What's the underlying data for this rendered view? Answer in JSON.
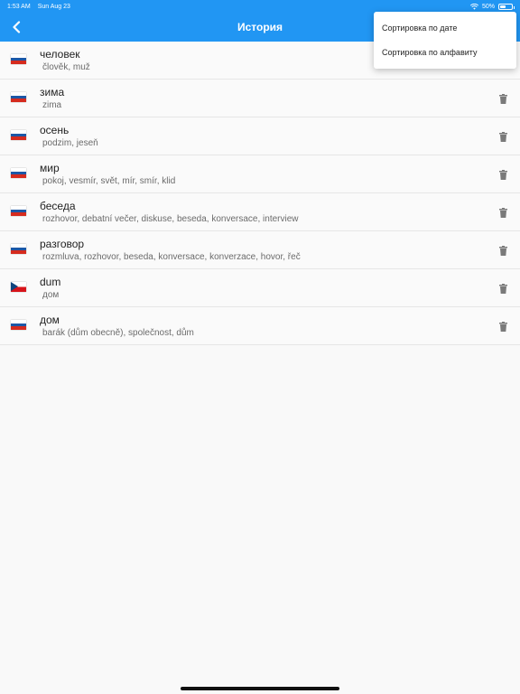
{
  "status": {
    "time": "1:53 AM",
    "date": "Sun Aug 23",
    "battery": "50%",
    "battery_level": 0.5
  },
  "header": {
    "title": "История"
  },
  "menu": {
    "items": [
      "Сортировка по дате",
      "Сортировка по алфавиту"
    ]
  },
  "history": [
    {
      "flag": "ru",
      "word": "человек",
      "translation": "člověk, muž"
    },
    {
      "flag": "ru",
      "word": "зима",
      "translation": "zima"
    },
    {
      "flag": "ru",
      "word": "осень",
      "translation": "podzim, jeseň"
    },
    {
      "flag": "ru",
      "word": "мир",
      "translation": "pokoj, vesmír, svět, mír, smír, klid"
    },
    {
      "flag": "ru",
      "word": "беседа",
      "translation": "rozhovor, debatní večer, diskuse, beseda, konversace, interview"
    },
    {
      "flag": "ru",
      "word": "разговор",
      "translation": "rozmluva, rozhovor, beseda, konversace, konverzace, hovor, řeč"
    },
    {
      "flag": "cz",
      "word": "dum",
      "translation": "дом"
    },
    {
      "flag": "ru",
      "word": "дом",
      "translation": "barák (dům obecně), společnost, dům"
    }
  ],
  "icons": {
    "back": "chevron-left-icon",
    "delete": "trash-icon",
    "wifi": "wifi-icon",
    "battery": "battery-icon"
  },
  "colors": {
    "accent": "#2196f3",
    "flag_ru": [
      "#ffffff",
      "#1c57a6",
      "#d52b1e"
    ],
    "flag_cz": [
      "#ffffff",
      "#d7141a",
      "#11457e"
    ]
  }
}
